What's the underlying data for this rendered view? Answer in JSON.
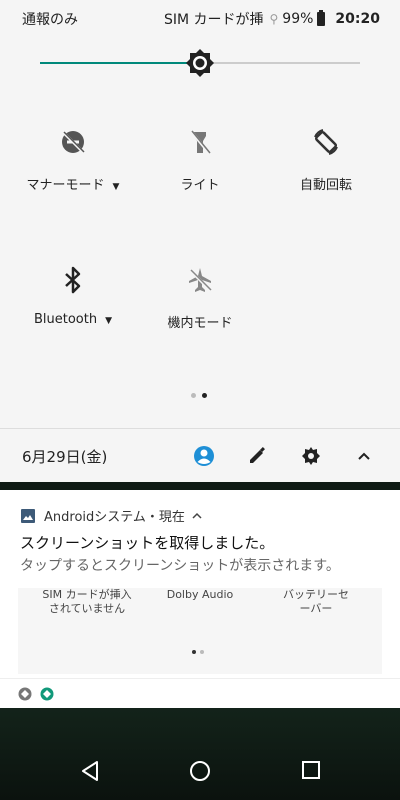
{
  "status_bar": {
    "left_text": "通報のみ",
    "carrier": "SIM カードが挿",
    "battery": "99%",
    "time": "20:20"
  },
  "brightness": {
    "level": 0.5,
    "accent": "#00897b"
  },
  "tiles": [
    {
      "label": "マナーモード",
      "icon": "do-not-disturb-off-icon",
      "has_menu": true
    },
    {
      "label": "ライト",
      "icon": "flashlight-off-icon",
      "has_menu": false
    },
    {
      "label": "自動回転",
      "icon": "auto-rotate-icon",
      "has_menu": false
    },
    {
      "label": "Bluetooth",
      "icon": "bluetooth-icon",
      "has_menu": true
    },
    {
      "label": "機内モード",
      "icon": "airplane-mode-off-icon",
      "has_menu": false
    }
  ],
  "date_bar": {
    "date": "6月29日(金)"
  },
  "notification": {
    "app": "Androidシステム・現在",
    "title": "スクリーンショットを取得しました。",
    "body": "タップするとスクリーンショットが表示されます。",
    "preview": {
      "items": [
        "SIM カードが挿入\nされていません",
        "Dolby Audio",
        "バッテリーセ\nーバー"
      ]
    }
  }
}
